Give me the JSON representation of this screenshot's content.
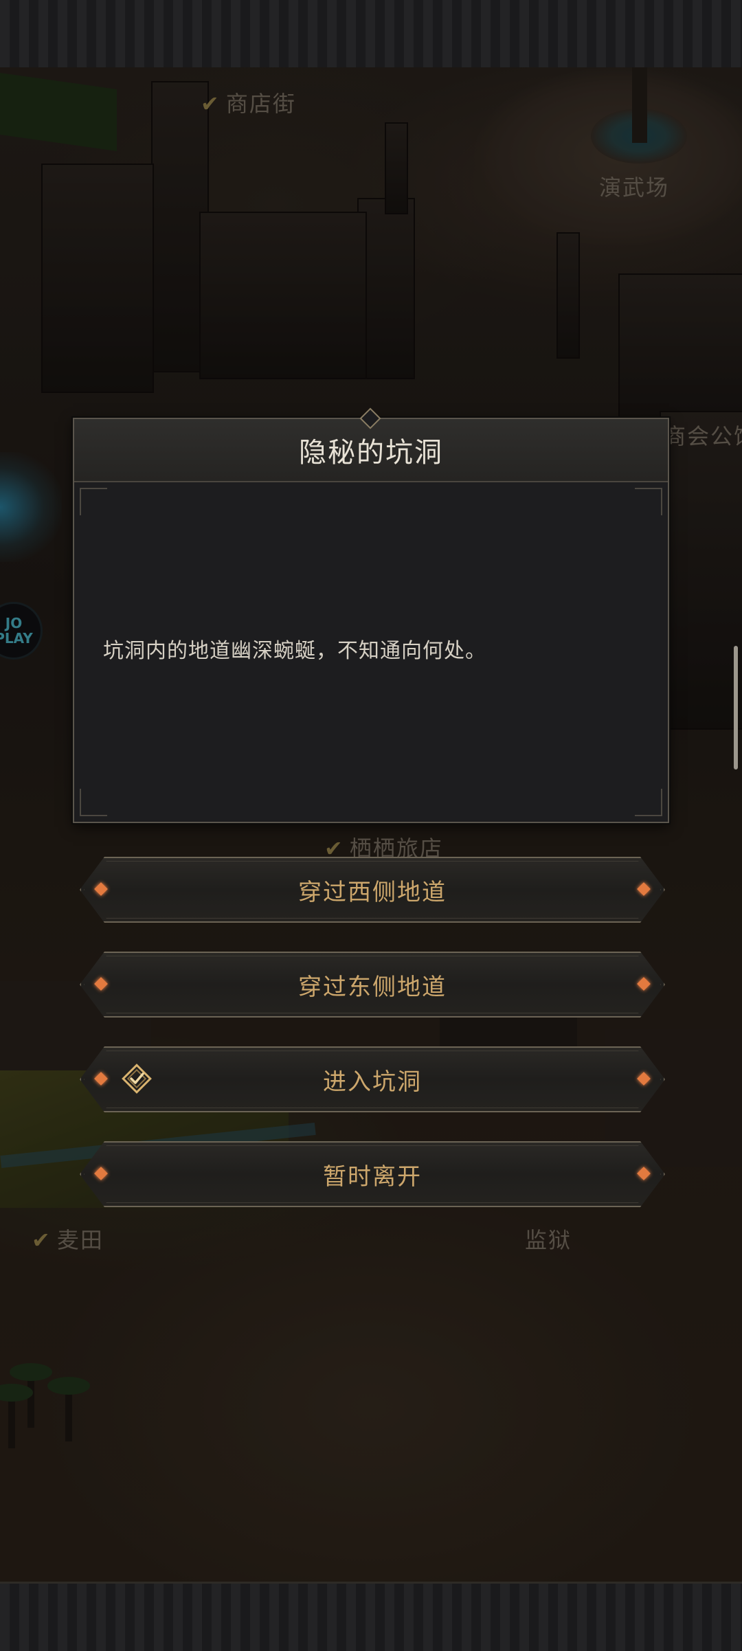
{
  "map": {
    "labels": {
      "shop_street": "商店街",
      "arena": "演武场",
      "guild_hall": "商会公馆",
      "inn": "栖栖旅店",
      "wheat_field": "麦田",
      "prison": "监狱"
    },
    "avatar_text": "JO\nPLAY"
  },
  "dialog": {
    "title": "隐秘的坑洞",
    "body": "坑洞内的地道幽深蜿蜒，不知通向何处。"
  },
  "choices": [
    {
      "label": "穿过西侧地道",
      "checked": false
    },
    {
      "label": "穿过东侧地道",
      "checked": false
    },
    {
      "label": "进入坑洞",
      "checked": true
    },
    {
      "label": "暂时离开",
      "checked": false
    }
  ],
  "colors": {
    "accent_gold": "#cda76c",
    "gem_orange": "#e37a3f",
    "panel_bg": "#1d1d1f",
    "body_text": "#d6d0c4"
  }
}
